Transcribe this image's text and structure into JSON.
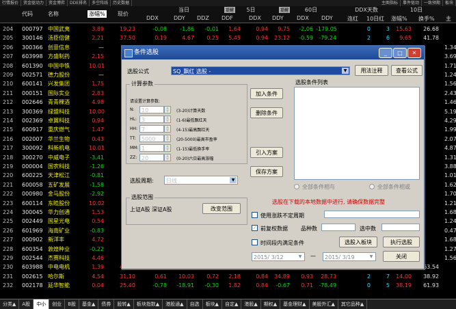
{
  "topbar": [
    "行情报价",
    "资金驱动力",
    "资金博弈",
    "DDE排名",
    "多空阵线",
    "历史数据"
  ],
  "topbar_right": [
    "主图指标",
    "事件驱动",
    "一致预期",
    "板块"
  ],
  "header": {
    "idx": "",
    "code": "代码",
    "name": "名称",
    "pct": "涨幅%",
    "price": "现价",
    "group_today": "当日",
    "group_5d": "5日",
    "group_60d": "60日",
    "group_ddx": "DDX天数",
    "group_10d": "10日",
    "badge1": "提醒",
    "badge2": "提醒",
    "sub": [
      "DDX",
      "DDY",
      "DDZ",
      "DDF",
      "DDX",
      "DDY",
      "DDX",
      "DDY",
      "连红",
      "10日红",
      "涨幅%",
      "换手%",
      "主"
    ]
  },
  "rows": [
    {
      "i": "204",
      "c": "000797",
      "n": "中国武夷",
      "p": "3.89",
      "pr": "19.23",
      "v": [
        "-0.08",
        "-1.86",
        "-0.01",
        "1.64",
        "0.94",
        "9.75",
        "-2.06",
        "-179.05",
        "0",
        "3",
        "15.63",
        "26.68",
        "-4"
      ]
    },
    {
      "i": "205",
      "c": "300146",
      "n": "汤臣倍健",
      "p": "2.21",
      "pr": "37.50",
      "v": [
        "0.19",
        "4.67",
        "0.25",
        "5.45",
        "0.94",
        "23.12",
        "-0.59",
        "-79.24",
        "2",
        "6",
        "9.65",
        "41.78",
        ""
      ]
    },
    {
      "i": "206",
      "c": "300366",
      "n": "创意信息",
      "p": "—",
      "pr": "",
      "v": []
    },
    {
      "i": "207",
      "c": "603998",
      "n": "方盛制药",
      "p": "2.15",
      "pr": "",
      "v": []
    },
    {
      "i": "208",
      "c": "601390",
      "n": "中国中铁",
      "p": "10.01",
      "pr": "",
      "v": []
    },
    {
      "i": "209",
      "c": "002571",
      "n": "德力股份",
      "p": "—",
      "pr": "",
      "v": []
    },
    {
      "i": "210",
      "c": "600141",
      "n": "兴发集团",
      "p": "1.75",
      "pr": "",
      "v": []
    },
    {
      "i": "211",
      "c": "000151",
      "n": "国际实业",
      "p": "2.83",
      "pr": "",
      "v": []
    },
    {
      "i": "212",
      "c": "002646",
      "n": "青青稞酒",
      "p": "4.98",
      "pr": "",
      "v": []
    },
    {
      "i": "213",
      "c": "300369",
      "n": "绿盟科技",
      "p": "10.00",
      "pr": "",
      "v": []
    },
    {
      "i": "214",
      "c": "002369",
      "n": "卓翼科技",
      "p": "0.94",
      "pr": "",
      "v": []
    },
    {
      "i": "215",
      "c": "600917",
      "n": "重庆燃气",
      "p": "1.47",
      "pr": "",
      "v": []
    },
    {
      "i": "216",
      "c": "002007",
      "n": "华兰生物",
      "p": "0.43",
      "pr": "",
      "v": []
    },
    {
      "i": "217",
      "c": "300092",
      "n": "科新机电",
      "p": "10.01",
      "pr": "",
      "v": []
    },
    {
      "i": "218",
      "c": "300270",
      "n": "中威电子",
      "p": "-3.41",
      "pr": "",
      "v": []
    },
    {
      "i": "219",
      "c": "000004",
      "n": "国农科技",
      "p": "-1.26",
      "pr": "",
      "v": []
    },
    {
      "i": "220",
      "c": "600225",
      "n": "天津松江",
      "p": "-0.81",
      "pr": "",
      "v": []
    },
    {
      "i": "221",
      "c": "600058",
      "n": "五矿发展",
      "p": "-1.58",
      "pr": "",
      "v": []
    },
    {
      "i": "222",
      "c": "000980",
      "n": "金马股份",
      "p": "-2.92",
      "pr": "",
      "v": []
    },
    {
      "i": "223",
      "c": "600114",
      "n": "东睦股份",
      "p": "10.02",
      "pr": "",
      "v": []
    },
    {
      "i": "224",
      "c": "300045",
      "n": "华力创通",
      "p": "1.53",
      "pr": "",
      "v": []
    },
    {
      "i": "225",
      "c": "002449",
      "n": "国星光电",
      "p": "0.54",
      "pr": "",
      "v": []
    },
    {
      "i": "226",
      "c": "601969",
      "n": "海南矿业",
      "p": "-0.83",
      "pr": "",
      "v": []
    },
    {
      "i": "227",
      "c": "000902",
      "n": "新洋丰",
      "p": "4.72",
      "pr": "",
      "v": []
    },
    {
      "i": "228",
      "c": "600354",
      "n": "敦煌种业",
      "p": "-0.22",
      "pr": "",
      "v": []
    },
    {
      "i": "229",
      "c": "002544",
      "n": "杰赛科技",
      "p": "4.46",
      "pr": "",
      "v": []
    },
    {
      "i": "230",
      "c": "603988",
      "n": "中电电机",
      "p": "1.39",
      "pr": "40.76",
      "v": [
        "0.26",
        "6.40",
        "-0.03",
        "1.58",
        "0.05",
        "25.42",
        "-0.21",
        "-78.09",
        "3",
        "3",
        "3.72",
        "63.54",
        ""
      ]
    },
    {
      "i": "231",
      "c": "002615",
      "n": "哈尔斯",
      "p": "4.54",
      "pr": "31.10",
      "v": [
        "0.61",
        "10.03",
        "0.72",
        "2.18",
        "0.84",
        "34.89",
        "0.93",
        "28.73",
        "2",
        "7",
        "14.00",
        "38.92",
        ""
      ]
    },
    {
      "i": "232",
      "c": "002178",
      "n": "延华智能",
      "p": "0.04",
      "pr": "25.40",
      "v": [
        "-0.78",
        "-18.91",
        "-0.30",
        "1.82",
        "0.84",
        "-0.67",
        "0.71",
        "-78.49",
        "0",
        "5",
        "38.19",
        "61.93",
        ""
      ]
    }
  ],
  "right_col": [
    "1.34",
    "3.69",
    "1.71",
    "1.24",
    "1.56",
    "2.43",
    "1.46",
    "5.19",
    "4.29",
    "1.99",
    "2.07",
    "4.87",
    "1.31",
    "3.88",
    "1.01",
    "1.62",
    "1.70",
    "1.21",
    "1.68",
    "1.24",
    "0.47",
    "1.68",
    "1.27",
    "1.56"
  ],
  "bottombar": [
    {
      "t": "分类▲",
      "a": false
    },
    {
      "t": "A股",
      "a": false
    },
    {
      "t": "中小",
      "a": true
    },
    {
      "t": "创业",
      "a": false
    },
    {
      "t": "B股",
      "a": false
    },
    {
      "t": "基金▲",
      "a": false
    },
    {
      "t": "债券",
      "a": false
    },
    {
      "t": "股转▲",
      "a": false
    },
    {
      "t": "板块指数▲",
      "a": false
    },
    {
      "t": "港股通▲",
      "a": false
    },
    {
      "t": "自选",
      "a": false
    },
    {
      "t": "板块▲",
      "a": false
    },
    {
      "t": "自定▲",
      "a": false
    },
    {
      "t": "港股▲",
      "a": false
    },
    {
      "t": "期权▲",
      "a": false
    },
    {
      "t": "基金理财▲",
      "a": false
    },
    {
      "t": "美股外汇▲",
      "a": false
    },
    {
      "t": "其它品种▲",
      "a": false
    }
  ],
  "dialog": {
    "title": "条件选股",
    "formula_label": "选股公式",
    "formula_value": "SQ_飘红 选股  -",
    "help_btn": "用法注释",
    "view_btn": "查看公式",
    "params_legend": "计算参数",
    "params_hint": "请设置计算参数:",
    "params": [
      {
        "k": "N:",
        "v": "10",
        "d": "(3-20)计算天数"
      },
      {
        "k": "HL:",
        "v": "3",
        "d": "(1-6)最低飘红天"
      },
      {
        "k": "HH:",
        "v": "7",
        "d": "(4-15)最高飘红天"
      },
      {
        "k": "TT:",
        "v": "5000",
        "d": "(20-5000)最高市盈率"
      },
      {
        "k": "MM:",
        "v": "1",
        "d": "(1-15)最低换手率"
      },
      {
        "k": "ZZ:",
        "v": "20",
        "d": "(0-20)六日最高涨幅"
      }
    ],
    "add_cond": "加入条件",
    "del_cond": "删除条件",
    "load_plan": "引入方案",
    "save_plan": "保存方案",
    "cond_list_label": "选股条件列表",
    "period_label": "选股周期:",
    "period_value": "日线",
    "radio_and": "全部条件相与",
    "radio_or": "全部条件相或",
    "range_legend": "选股范围",
    "range_value": "上证A股  深证A股",
    "change_range": "改变范围",
    "warning": "选股在下载的本地数据中进行, 请确保数据完整",
    "chk_skip": "使用涨跌不定周期",
    "chk_fq": "前复权数据",
    "var_label": "品种数",
    "hit_label": "选中数",
    "chk_time": "时间段内满足条件",
    "to_block": "选股入板块",
    "run": "执行选股",
    "close": "关闭",
    "date_from": "2015/ 3/12",
    "date_to": "2015/ 3/19",
    "dash": "—"
  }
}
